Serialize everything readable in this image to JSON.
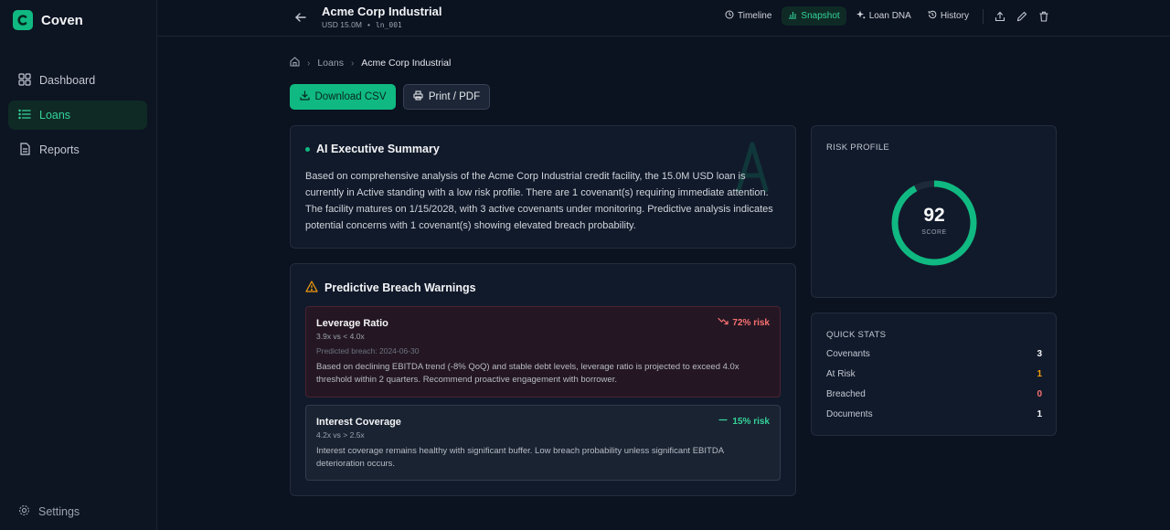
{
  "brand": {
    "name": "Coven",
    "accent": "#10b981"
  },
  "sidebar": {
    "items": [
      {
        "label": "Dashboard",
        "icon": "grid-icon",
        "active": false
      },
      {
        "label": "Loans",
        "icon": "list-icon",
        "active": true
      },
      {
        "label": "Reports",
        "icon": "file-icon",
        "active": false
      }
    ],
    "settings_label": "Settings"
  },
  "header": {
    "title": "Acme Corp Industrial",
    "amount": "USD 15.0M",
    "separator": "•",
    "loan_id": "ln_001",
    "tabs": [
      {
        "label": "Timeline",
        "icon": "clock-icon",
        "active": false
      },
      {
        "label": "Snapshot",
        "icon": "bar-chart-icon",
        "active": true
      },
      {
        "label": "Loan DNA",
        "icon": "sparkle-icon",
        "active": false
      },
      {
        "label": "History",
        "icon": "history-icon",
        "active": false
      }
    ]
  },
  "breadcrumb": {
    "loans": "Loans",
    "current": "Acme Corp Industrial"
  },
  "actions": {
    "download_csv": "Download CSV",
    "print_pdf": "Print / PDF"
  },
  "summary": {
    "title": "AI Executive Summary",
    "text": "Based on comprehensive analysis of the Acme Corp Industrial credit facility, the 15.0M USD loan is currently in Active standing with a low risk profile. There are 1 covenant(s) requiring immediate attention. The facility matures on 1/15/2028, with 3 active covenants under monitoring. Predictive analysis indicates potential concerns with 1 covenant(s) showing elevated breach probability."
  },
  "warnings": {
    "title": "Predictive Breach Warnings",
    "items": [
      {
        "name": "Leverage Ratio",
        "ratio": "3.9x vs < 4.0x",
        "predicted": "Predicted breach: 2024-06-30",
        "risk": "72% risk",
        "description": "Based on declining EBITDA trend (-8% QoQ) and stable debt levels, leverage ratio is projected to exceed 4.0x threshold within 2 quarters. Recommend proactive engagement with borrower."
      },
      {
        "name": "Interest Coverage",
        "ratio": "4.2x vs > 2.5x",
        "risk": "15% risk",
        "description": "Interest coverage remains healthy with significant buffer. Low breach probability unless significant EBITDA deterioration occurs."
      }
    ]
  },
  "risk_profile": {
    "label": "RISK PROFILE",
    "score": "92",
    "score_label": "SCORE",
    "score_value": 92,
    "score_max": 100
  },
  "quick_stats": {
    "label": "QUICK STATS",
    "rows": [
      {
        "label": "Covenants",
        "value": "3",
        "color": "#f3f4f6"
      },
      {
        "label": "At Risk",
        "value": "1",
        "color": "#f59e0b"
      },
      {
        "label": "Breached",
        "value": "0",
        "color": "#f87171"
      },
      {
        "label": "Documents",
        "value": "1",
        "color": "#f3f4f6"
      }
    ]
  }
}
